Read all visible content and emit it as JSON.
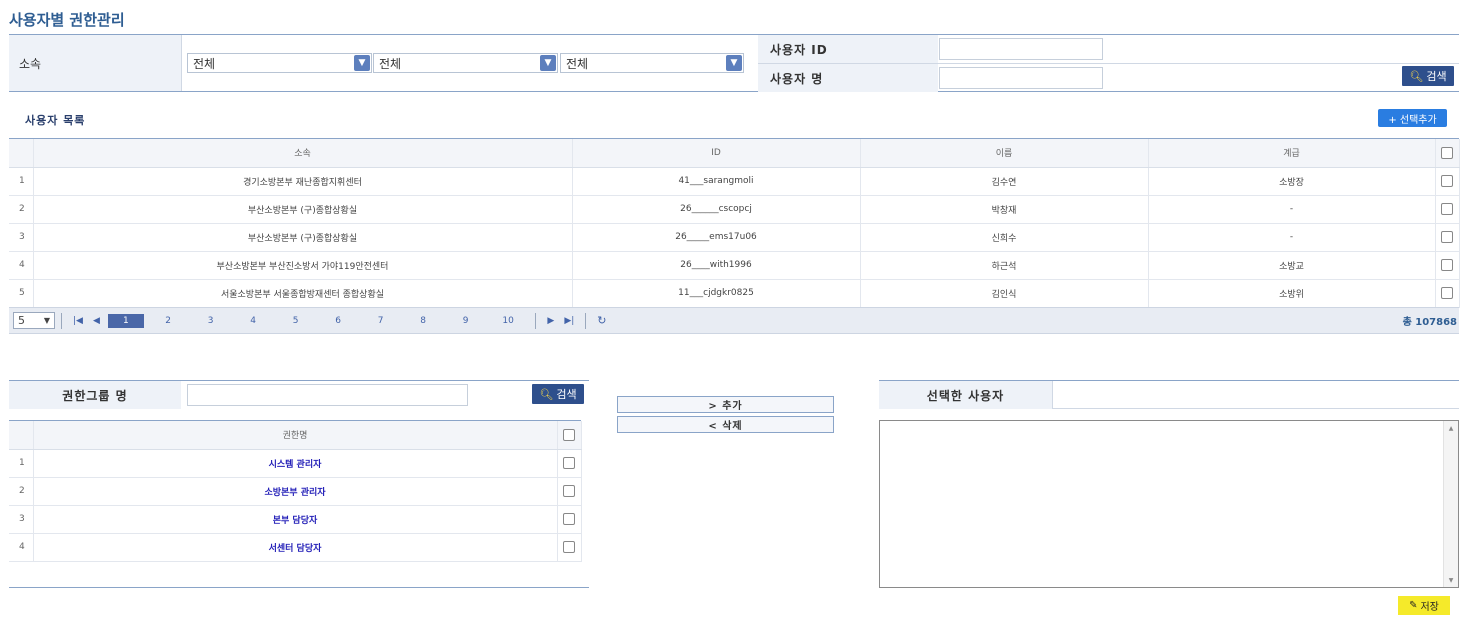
{
  "page_title": "사용자별 권한관리",
  "search": {
    "org_label": "소속",
    "selects": [
      "전체",
      "전체",
      "전체"
    ],
    "user_id_label": "사용자 ID",
    "user_name_label": "사용자 명",
    "user_id_value": "",
    "user_name_value": "",
    "search_label": "검색"
  },
  "user_list": {
    "title": "사용자 목록",
    "add_selected_label": "+ 선택추가",
    "columns": [
      "소속",
      "ID",
      "이름",
      "계급"
    ],
    "rows": [
      {
        "no": "1",
        "org": "경기소방본부 재난종합지휘센터",
        "id": "41___sarangmoli",
        "name": "김수연",
        "rank": "소방장"
      },
      {
        "no": "2",
        "org": "부산소방본부 (구)종합상황실",
        "id": "26______cscopcj",
        "name": "박창재",
        "rank": "-"
      },
      {
        "no": "3",
        "org": "부산소방본부 (구)종합상황실",
        "id": "26_____ems17u06",
        "name": "신희수",
        "rank": "-"
      },
      {
        "no": "4",
        "org": "부산소방본부 부산진소방서 가야119안전센터",
        "id": "26____with1996",
        "name": "하근석",
        "rank": "소방교"
      },
      {
        "no": "5",
        "org": "서울소방본부 서울종합방재센터 종합상황실",
        "id": "11___cjdgkr0825",
        "name": "김인식",
        "rank": "소방위"
      }
    ]
  },
  "pager": {
    "page_size": "5",
    "pages": [
      "1",
      "2",
      "3",
      "4",
      "5",
      "6",
      "7",
      "8",
      "9",
      "10"
    ],
    "current": "1",
    "total": "총 107868"
  },
  "perm_group": {
    "label": "권한그룹 명",
    "input_value": "",
    "search_label": "검색",
    "column": "권한명",
    "rows": [
      {
        "no": "1",
        "name": "시스템 관리자"
      },
      {
        "no": "2",
        "name": "소방본부 관리자"
      },
      {
        "no": "3",
        "name": "본부 담당자"
      },
      {
        "no": "4",
        "name": "서센터 담당자"
      }
    ]
  },
  "actions": {
    "add_label": "> 추가",
    "remove_label": "< 삭제"
  },
  "selected_users": {
    "label": "선택한 사용자",
    "save_label": "저장"
  },
  "colors": {
    "accent": "#2e4f8c",
    "add_button": "#2a7de1",
    "save_button": "#f5ea2a",
    "link": "#2420b8"
  }
}
